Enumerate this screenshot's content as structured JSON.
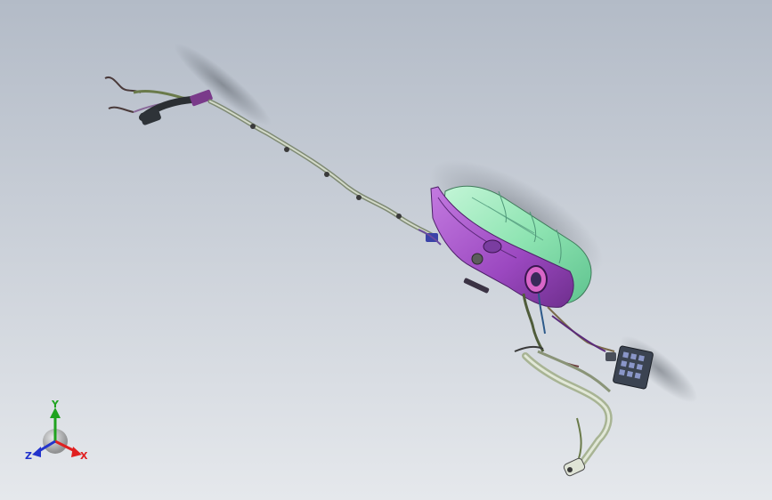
{
  "viewport": {
    "background_top": "#b4bcc8",
    "background_bottom": "#e4e7eb"
  },
  "model": {
    "tank_color": "#8fe6b4",
    "bracket_color": "#a24fc8",
    "pipe_color": "#9aa58c",
    "wire_color": "#4f5c3a",
    "connector_color": "#3b4351"
  },
  "triad": {
    "x_label": "X",
    "y_label": "Y",
    "z_label": "Z",
    "x_color": "#e02020",
    "y_color": "#1fa31f",
    "z_color": "#2233cc"
  }
}
